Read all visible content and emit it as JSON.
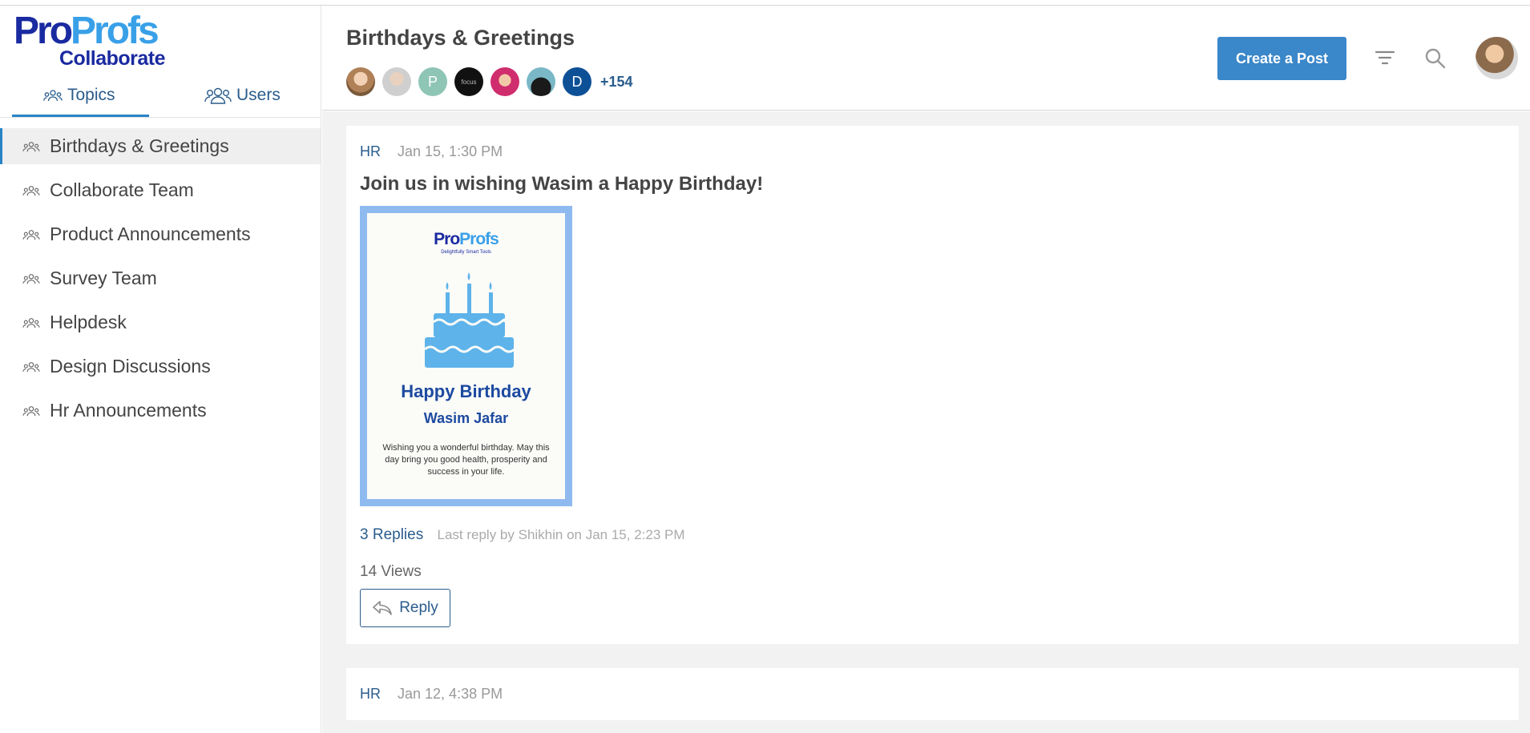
{
  "brand": {
    "logo_part1": "Pro",
    "logo_part2": "Profs",
    "logo_sub": "Collaborate"
  },
  "sidebar": {
    "tabs": [
      {
        "label": "Topics",
        "icon": "users-group-icon",
        "active": true
      },
      {
        "label": "Users",
        "icon": "users-icon",
        "active": false
      }
    ],
    "topics": [
      {
        "label": "Birthdays & Greetings",
        "active": true
      },
      {
        "label": "Collaborate Team"
      },
      {
        "label": "Product Announcements"
      },
      {
        "label": "Survey Team"
      },
      {
        "label": "Helpdesk"
      },
      {
        "label": "Design Discussions"
      },
      {
        "label": "Hr Announcements"
      }
    ]
  },
  "header": {
    "title": "Birthdays & Greetings",
    "avatars": [
      "",
      "",
      "P",
      "focus",
      "",
      "",
      "D"
    ],
    "more_members": "+154",
    "create_post_label": "Create a Post"
  },
  "posts": [
    {
      "author": "HR",
      "time": "Jan 15, 1:30 PM",
      "title": "Join us in wishing Wasim a Happy Birthday!",
      "card": {
        "logo_part1": "Pro",
        "logo_part2": "Profs",
        "tagline": "Delightfully Smart Tools",
        "heading": "Happy Birthday",
        "name": "Wasim Jafar",
        "message": "Wishing you a wonderful birthday. May this day bring you good health, prosperity and success in your life."
      },
      "replies": "3 Replies",
      "last_reply": "Last reply by Shikhin on Jan 15, 2:23 PM",
      "views": "14 Views",
      "reply_label": "Reply"
    },
    {
      "author": "HR",
      "time": "Jan 12, 4:38 PM"
    }
  ],
  "colors": {
    "accent": "#3a87c9",
    "link": "#2a5c8c",
    "card_border": "#8fbaf0"
  }
}
